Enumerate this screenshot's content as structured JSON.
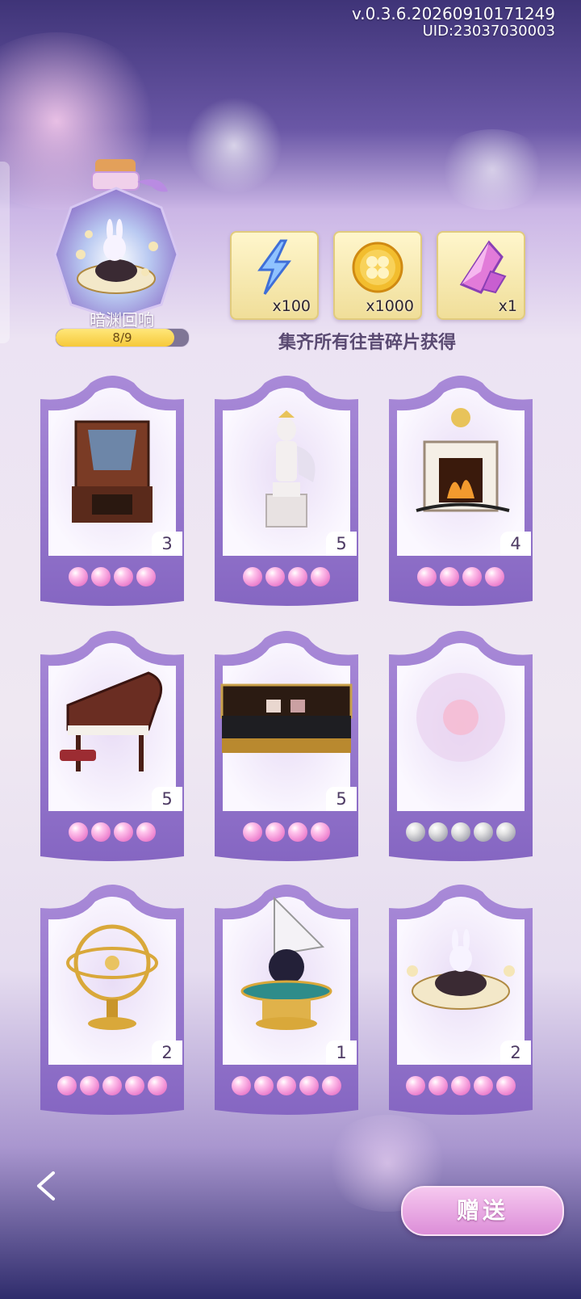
{
  "header": {
    "version": "v.0.3.6.20260910171249",
    "uid": "UID:23037030003"
  },
  "collection": {
    "name": "暗渊回响",
    "progress_text": "8/9",
    "progress_fraction": 0.889,
    "caption": "集齐所有往昔碎片获得"
  },
  "rewards": [
    {
      "icon": "lightning-icon",
      "qty": "x100"
    },
    {
      "icon": "clover-coin-icon",
      "qty": "x1000"
    },
    {
      "icon": "pink-crystal-icon",
      "qty": "x1"
    }
  ],
  "fragments": [
    {
      "item": "fireplace-cabinet",
      "count": "3",
      "pips": 4,
      "pip_color": "pink"
    },
    {
      "item": "knight-statue",
      "count": "5",
      "pips": 4,
      "pip_color": "pink"
    },
    {
      "item": "fireplace",
      "count": "4",
      "pips": 4,
      "pip_color": "pink"
    },
    {
      "item": "grand-piano",
      "count": "5",
      "pips": 4,
      "pip_color": "pink"
    },
    {
      "item": "sofa",
      "count": "5",
      "pips": 4,
      "pip_color": "pink"
    },
    {
      "item": "locked-fragment",
      "count": "",
      "pips": 5,
      "pip_color": "grey"
    },
    {
      "item": "armillary-sphere",
      "count": "2",
      "pips": 5,
      "pip_color": "pink"
    },
    {
      "item": "sail-globe-table",
      "count": "1",
      "pips": 5,
      "pip_color": "pink"
    },
    {
      "item": "rabbit-teacup",
      "count": "2",
      "pips": 5,
      "pip_color": "pink"
    }
  ],
  "footer": {
    "back_icon": "chevron-left-icon",
    "gift_label": "赠送"
  },
  "colors": {
    "card_purple": "#8e6fc9",
    "pip_pink": "#f08bd3",
    "pip_grey": "#a9a9b3",
    "progress_yellow": "#f6c93a"
  }
}
